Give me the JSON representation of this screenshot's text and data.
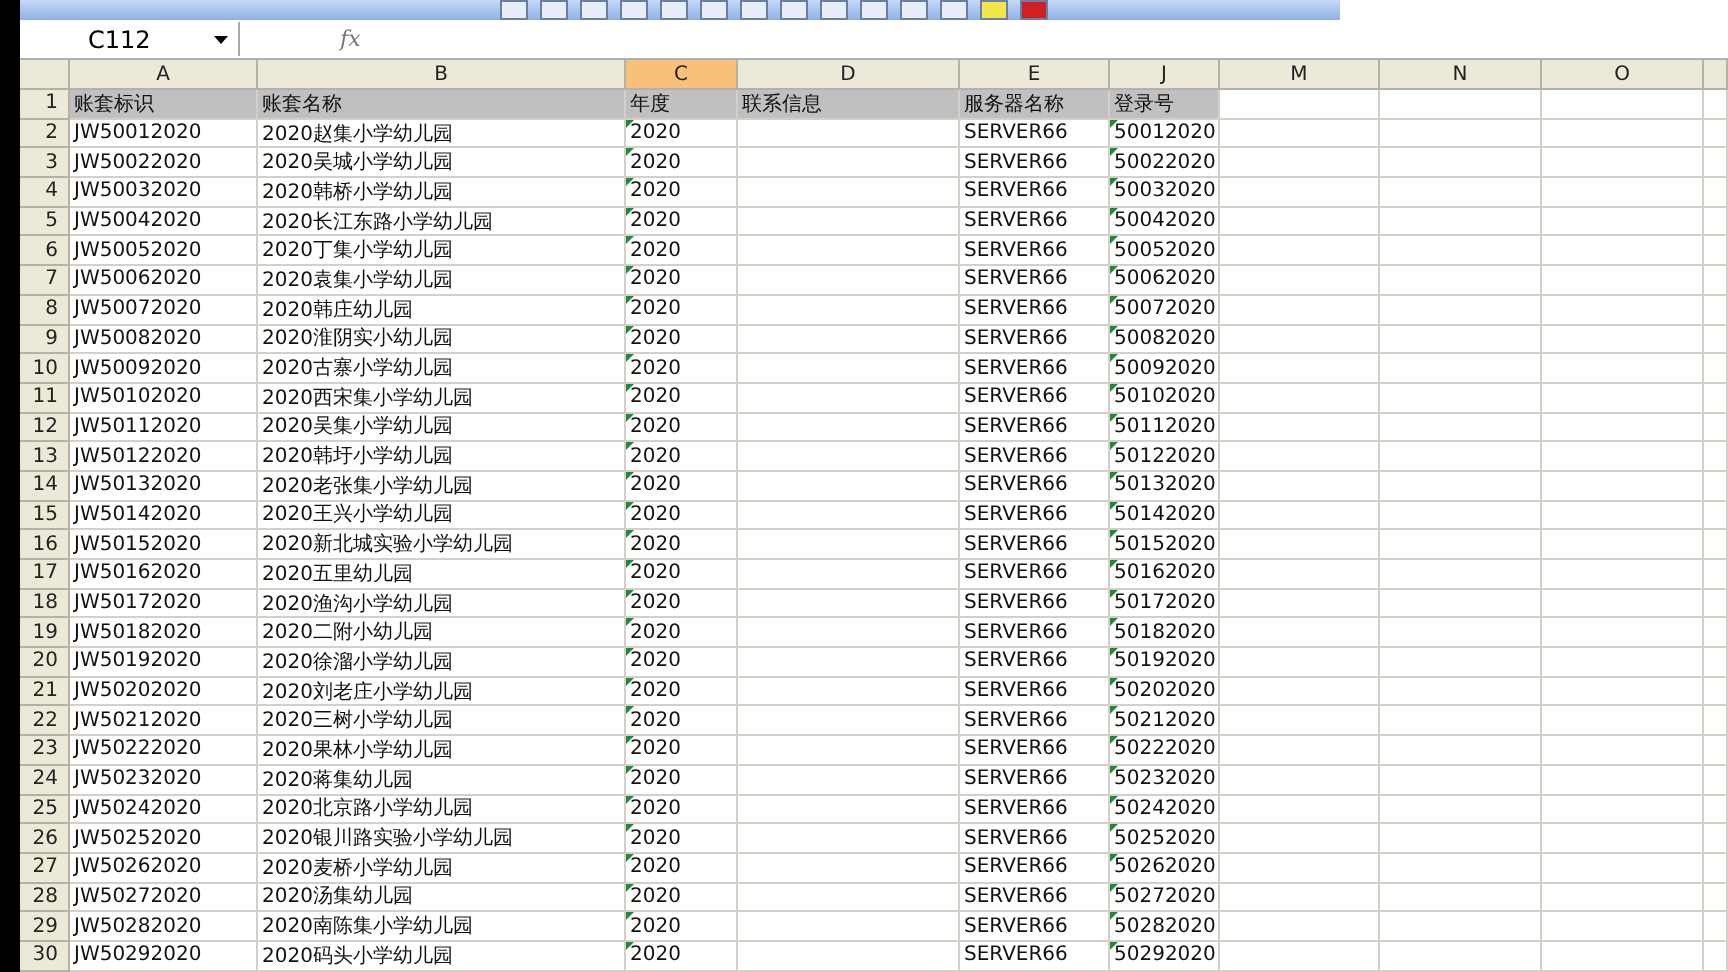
{
  "name_box": {
    "value": "C112"
  },
  "formula_bar": {
    "fx_label": "fx"
  },
  "columns": [
    {
      "letter": "A",
      "selected": false,
      "flagged": false
    },
    {
      "letter": "B",
      "selected": false,
      "flagged": false
    },
    {
      "letter": "C",
      "selected": true,
      "flagged": true
    },
    {
      "letter": "D",
      "selected": false,
      "flagged": false
    },
    {
      "letter": "E",
      "selected": false,
      "flagged": false
    },
    {
      "letter": "J",
      "selected": false,
      "flagged": true
    },
    {
      "letter": "M",
      "selected": false,
      "flagged": false
    },
    {
      "letter": "N",
      "selected": false,
      "flagged": false
    },
    {
      "letter": "O",
      "selected": false,
      "flagged": false
    }
  ],
  "header_row": {
    "number": "1",
    "cells": [
      "账套标识",
      "账套名称",
      "年度",
      "联系信息",
      "服务器名称",
      "登录号"
    ]
  },
  "rows": [
    {
      "number": "2",
      "cells": [
        "JW50012020",
        "2020赵集小学幼儿园",
        "2020",
        "",
        "SERVER66",
        "50012020"
      ]
    },
    {
      "number": "3",
      "cells": [
        "JW50022020",
        "2020吴城小学幼儿园",
        "2020",
        "",
        "SERVER66",
        "50022020"
      ]
    },
    {
      "number": "4",
      "cells": [
        "JW50032020",
        "2020韩桥小学幼儿园",
        "2020",
        "",
        "SERVER66",
        "50032020"
      ]
    },
    {
      "number": "5",
      "cells": [
        "JW50042020",
        "2020长江东路小学幼儿园",
        "2020",
        "",
        "SERVER66",
        "50042020"
      ]
    },
    {
      "number": "6",
      "cells": [
        "JW50052020",
        "2020丁集小学幼儿园",
        "2020",
        "",
        "SERVER66",
        "50052020"
      ]
    },
    {
      "number": "7",
      "cells": [
        "JW50062020",
        "2020袁集小学幼儿园",
        "2020",
        "",
        "SERVER66",
        "50062020"
      ]
    },
    {
      "number": "8",
      "cells": [
        "JW50072020",
        "2020韩庄幼儿园",
        "2020",
        "",
        "SERVER66",
        "50072020"
      ]
    },
    {
      "number": "9",
      "cells": [
        "JW50082020",
        "2020淮阴实小幼儿园",
        "2020",
        "",
        "SERVER66",
        "50082020"
      ]
    },
    {
      "number": "10",
      "cells": [
        "JW50092020",
        "2020古寨小学幼儿园",
        "2020",
        "",
        "SERVER66",
        "50092020"
      ]
    },
    {
      "number": "11",
      "cells": [
        "JW50102020",
        "2020西宋集小学幼儿园",
        "2020",
        "",
        "SERVER66",
        "50102020"
      ]
    },
    {
      "number": "12",
      "cells": [
        "JW50112020",
        "2020吴集小学幼儿园",
        "2020",
        "",
        "SERVER66",
        "50112020"
      ]
    },
    {
      "number": "13",
      "cells": [
        "JW50122020",
        "2020韩圩小学幼儿园",
        "2020",
        "",
        "SERVER66",
        "50122020"
      ]
    },
    {
      "number": "14",
      "cells": [
        "JW50132020",
        "2020老张集小学幼儿园",
        "2020",
        "",
        "SERVER66",
        "50132020"
      ]
    },
    {
      "number": "15",
      "cells": [
        "JW50142020",
        "2020王兴小学幼儿园",
        "2020",
        "",
        "SERVER66",
        "50142020"
      ]
    },
    {
      "number": "16",
      "cells": [
        "JW50152020",
        "2020新北城实验小学幼儿园",
        "2020",
        "",
        "SERVER66",
        "50152020"
      ]
    },
    {
      "number": "17",
      "cells": [
        "JW50162020",
        "2020五里幼儿园",
        "2020",
        "",
        "SERVER66",
        "50162020"
      ]
    },
    {
      "number": "18",
      "cells": [
        "JW50172020",
        "2020渔沟小学幼儿园",
        "2020",
        "",
        "SERVER66",
        "50172020"
      ]
    },
    {
      "number": "19",
      "cells": [
        "JW50182020",
        "2020二附小幼儿园",
        "2020",
        "",
        "SERVER66",
        "50182020"
      ]
    },
    {
      "number": "20",
      "cells": [
        "JW50192020",
        "2020徐溜小学幼儿园",
        "2020",
        "",
        "SERVER66",
        "50192020"
      ]
    },
    {
      "number": "21",
      "cells": [
        "JW50202020",
        "2020刘老庄小学幼儿园",
        "2020",
        "",
        "SERVER66",
        "50202020"
      ]
    },
    {
      "number": "22",
      "cells": [
        "JW50212020",
        "2020三树小学幼儿园",
        "2020",
        "",
        "SERVER66",
        "50212020"
      ]
    },
    {
      "number": "23",
      "cells": [
        "JW50222020",
        "2020果林小学幼儿园",
        "2020",
        "",
        "SERVER66",
        "50222020"
      ]
    },
    {
      "number": "24",
      "cells": [
        "JW50232020",
        "2020蒋集幼儿园",
        "2020",
        "",
        "SERVER66",
        "50232020"
      ]
    },
    {
      "number": "25",
      "cells": [
        "JW50242020",
        "2020北京路小学幼儿园",
        "2020",
        "",
        "SERVER66",
        "50242020"
      ]
    },
    {
      "number": "26",
      "cells": [
        "JW50252020",
        "2020银川路实验小学幼儿园",
        "2020",
        "",
        "SERVER66",
        "50252020"
      ]
    },
    {
      "number": "27",
      "cells": [
        "JW50262020",
        "2020麦桥小学幼儿园",
        "2020",
        "",
        "SERVER66",
        "50262020"
      ]
    },
    {
      "number": "28",
      "cells": [
        "JW50272020",
        "2020汤集幼儿园",
        "2020",
        "",
        "SERVER66",
        "50272020"
      ]
    },
    {
      "number": "29",
      "cells": [
        "JW50282020",
        "2020南陈集小学幼儿园",
        "2020",
        "",
        "SERVER66",
        "50282020"
      ]
    },
    {
      "number": "30",
      "cells": [
        "JW50292020",
        "2020码头小学幼儿园",
        "2020",
        "",
        "SERVER66",
        "50292020"
      ]
    }
  ]
}
